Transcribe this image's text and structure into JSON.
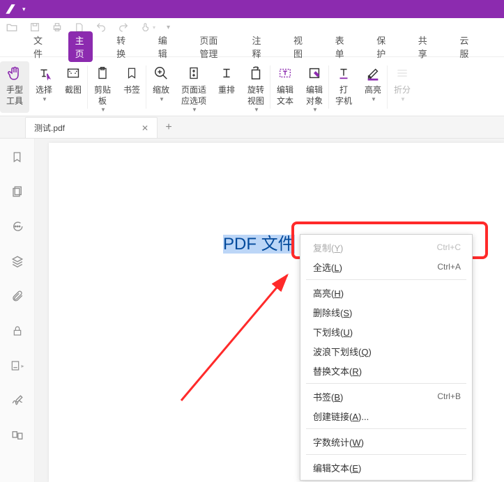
{
  "colors": {
    "accent": "#8c2baf",
    "highlight_red": "#ff2a2a"
  },
  "menubar": {
    "items": [
      "文件",
      "主页",
      "转换",
      "编辑",
      "页面管理",
      "注释",
      "视图",
      "表单",
      "保护",
      "共享",
      "云服"
    ],
    "active_index": 1
  },
  "ribbon": {
    "groups": [
      {
        "label": "手型\n工具",
        "icon": "hand-icon",
        "active": true,
        "dropdown": false
      },
      {
        "label": "选择",
        "icon": "text-select-icon",
        "dropdown": true
      },
      {
        "label": "截图",
        "icon": "screenshot-icon",
        "dropdown": false,
        "sep": true
      },
      {
        "label": "剪贴\n板",
        "icon": "clipboard-icon",
        "dropdown": true
      },
      {
        "label": "书签",
        "icon": "bookmark-icon",
        "dropdown": false,
        "sep": true
      },
      {
        "label": "缩放",
        "icon": "zoom-icon",
        "dropdown": true
      },
      {
        "label": "页面适\n应选项",
        "icon": "fitpage-icon",
        "dropdown": true
      },
      {
        "label": "重排",
        "icon": "reflow-icon",
        "dropdown": false
      },
      {
        "label": "旋转\n视图",
        "icon": "rotate-icon",
        "dropdown": true,
        "sep": true
      },
      {
        "label": "编辑\n文本",
        "icon": "edit-text-icon",
        "dropdown": false
      },
      {
        "label": "编辑\n对象",
        "icon": "edit-object-icon",
        "dropdown": true,
        "sep": true
      },
      {
        "label": "打\n字机",
        "icon": "typewriter-icon",
        "dropdown": false
      },
      {
        "label": "高亮",
        "icon": "highlight-icon",
        "dropdown": true,
        "sep": true
      },
      {
        "label": "折分",
        "icon": "split-icon",
        "dropdown": true,
        "disabled": true
      }
    ]
  },
  "tab": {
    "name": "测试.pdf"
  },
  "selected_text": "PDF 文件",
  "context_menu": {
    "groups": [
      [
        {
          "label": "复制",
          "key": "Y",
          "shortcut": "Ctrl+C",
          "disabled": true
        },
        {
          "label": "全选",
          "key": "L",
          "shortcut": "Ctrl+A"
        }
      ],
      [
        {
          "label": "高亮",
          "key": "H"
        },
        {
          "label": "删除线",
          "key": "S"
        },
        {
          "label": "下划线",
          "key": "U"
        },
        {
          "label": "波浪下划线",
          "key": "Q"
        },
        {
          "label": "替换文本",
          "key": "R"
        }
      ],
      [
        {
          "label": "书签",
          "key": "B",
          "shortcut": "Ctrl+B"
        },
        {
          "label": "创建链接",
          "key": "A",
          "suffix": "..."
        }
      ],
      [
        {
          "label": "字数统计",
          "key": "W"
        }
      ],
      [
        {
          "label": "编辑文本",
          "key": "E"
        }
      ]
    ]
  }
}
